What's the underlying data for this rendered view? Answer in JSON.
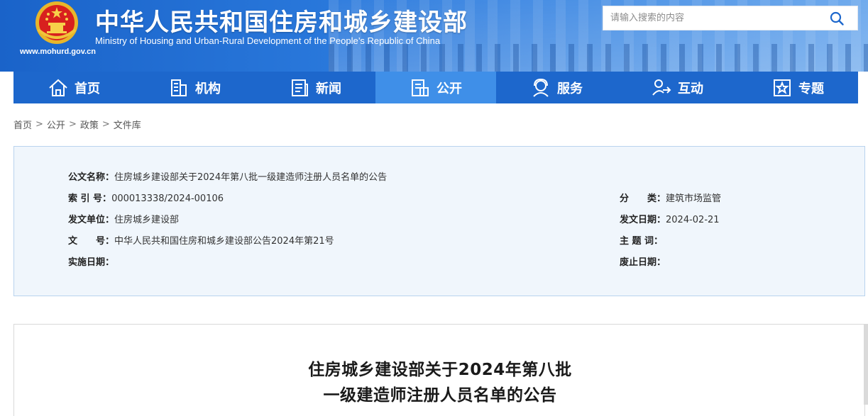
{
  "header": {
    "site_url": "www.mohurd.gov.cn",
    "title_cn": "中华人民共和国住房和城乡建设部",
    "title_en": "Ministry of Housing and Urban-Rural Development of the People’s Republic of China",
    "search_placeholder": "请输入搜索的内容",
    "brand_color": "#1d67cc"
  },
  "nav": [
    {
      "label": "首页",
      "icon": "home-icon"
    },
    {
      "label": "机构",
      "icon": "building-icon"
    },
    {
      "label": "新闻",
      "icon": "newspaper-icon"
    },
    {
      "label": "公开",
      "icon": "document-list-icon",
      "active": true
    },
    {
      "label": "服务",
      "icon": "service-person-icon"
    },
    {
      "label": "互动",
      "icon": "interaction-icon"
    },
    {
      "label": "专题",
      "icon": "star-frame-icon"
    }
  ],
  "breadcrumb": [
    "首页",
    "公开",
    "政策",
    "文件库"
  ],
  "breadcrumb_sep": ">",
  "meta": {
    "name_label": "公文名称：",
    "name_value": "住房城乡建设部关于2024年第八批一级建造师注册人员名单的公告",
    "index_label": "索 引 号：",
    "index_value": "000013338/2024-00106",
    "category_label": "分　　类：",
    "category_value": "建筑市场监管",
    "issuer_label": "发文单位：",
    "issuer_value": "住房城乡建设部",
    "date_label": "发文日期：",
    "date_value": "2024-02-21",
    "docno_label": "文　　号：",
    "docno_value": "中华人民共和国住房和城乡建设部公告2024年第21号",
    "keywords_label": "主 题 词：",
    "keywords_value": "",
    "effective_label": "实施日期：",
    "effective_value": "",
    "expire_label": "废止日期：",
    "expire_value": ""
  },
  "article": {
    "title_line1": "住房城乡建设部关于2024年第八批",
    "title_line2": "一级建造师注册人员名单的公告"
  }
}
